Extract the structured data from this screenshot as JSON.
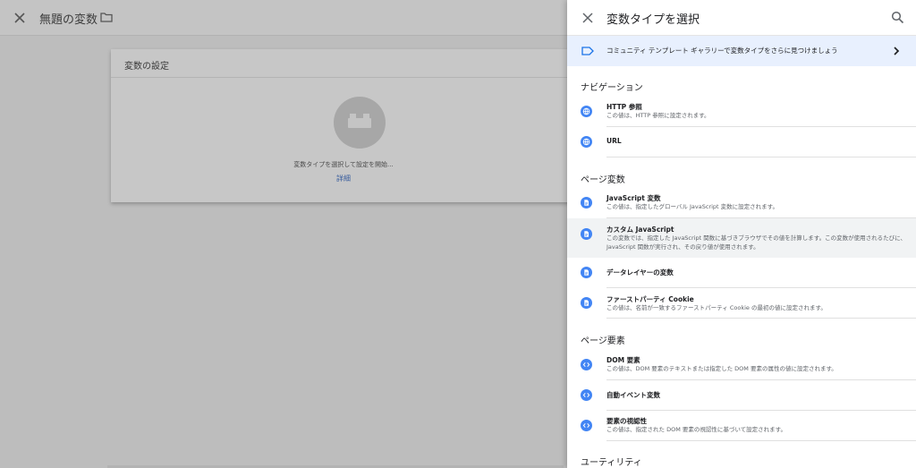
{
  "background": {
    "title": "無題の変数",
    "card_header": "変数の設定",
    "hint": "変数タイプを選択して設定を開始...",
    "link": "詳細"
  },
  "panel": {
    "title": "変数タイプを選択",
    "community": "コミュニティ テンプレート ギャラリーで変数タイプをさらに見つけましょう",
    "sections": [
      {
        "title": "ナビゲーション",
        "items": [
          {
            "name": "HTTP 参照",
            "desc": "この値は、HTTP 参照に設定されます。",
            "icon": "globe-icon"
          },
          {
            "name": "URL",
            "desc": "",
            "icon": "globe-icon"
          }
        ]
      },
      {
        "title": "ページ変数",
        "items": [
          {
            "name": "JavaScript 変数",
            "desc": "この値は、指定したグローバル JavaScript 変数に設定されます。",
            "icon": "document-icon"
          },
          {
            "name": "カスタム JavaScript",
            "desc": "この変数では、指定した JavaScript 関数に基づきブラウザでその値を計算します。この変数が使用されるたびに、JavaScript 関数が実行され、その戻り値が使用されます。",
            "icon": "document-icon"
          },
          {
            "name": "データレイヤーの変数",
            "desc": "",
            "icon": "document-icon"
          },
          {
            "name": "ファーストパーティ Cookie",
            "desc": "この値は、名前が一致するファーストパーティ Cookie の最初の値に設定されます。",
            "icon": "document-icon"
          }
        ]
      },
      {
        "title": "ページ要素",
        "items": [
          {
            "name": "DOM 要素",
            "desc": "この値は、DOM 要素のテキストまたは指定した DOM 要素の属性の値に設定されます。",
            "icon": "code-icon"
          },
          {
            "name": "自動イベント変数",
            "desc": "",
            "icon": "code-icon"
          },
          {
            "name": "要素の視認性",
            "desc": "この値は、指定された DOM 要素の視認性に基づいて設定されます。",
            "icon": "code-icon"
          }
        ]
      },
      {
        "title": "ユーティリティ",
        "items": []
      }
    ]
  },
  "colors": {
    "accent": "#4285f4",
    "community_bg": "#e8f0fe",
    "highlight_bg": "#f1f3f4"
  }
}
